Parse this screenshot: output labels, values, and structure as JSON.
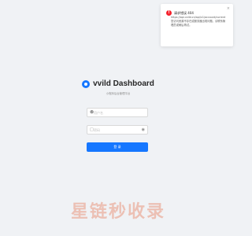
{
  "notification": {
    "title": "请求错误 404",
    "url": "https://api.vvild.cn/api/v1/account/current",
    "message": "您访问资源不存在或服务器出现问题，请联系管理员或稍后再试。",
    "close_glyph": "×",
    "icon": "error-icon"
  },
  "brand": {
    "title": "vvild Dashboard",
    "subtitle": "小程序后台管理平台"
  },
  "form": {
    "username_placeholder": "用户名",
    "password_placeholder": "密码",
    "submit_label": "登 录"
  },
  "watermark": "星链秒收录",
  "colors": {
    "primary": "#1677ff",
    "error": "#f5222d",
    "background": "#f0f2f5"
  }
}
